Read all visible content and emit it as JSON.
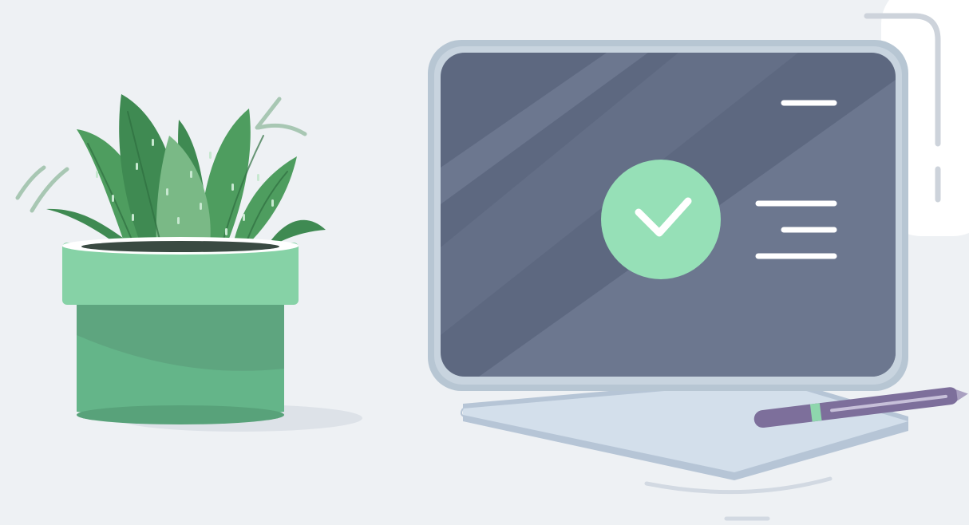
{
  "scene": {
    "subject": "",
    "colors": {
      "background": "#eef1f4",
      "card": "#ffffff",
      "card_outline": "#cdd3db",
      "pot_rim": "#86d2a6",
      "pot_body": "#64b589",
      "pot_shadow": "#58a27a",
      "leaf_dark": "#3f8a52",
      "leaf_mid": "#4e9d5f",
      "leaf_light": "#7ab986",
      "monitor_bezel": "#b7c6d3",
      "screen": "#5d6880",
      "check_circle": "#96e0b7",
      "stand": "#cfdbe8",
      "pen": "#7d6f9b"
    },
    "icons": {
      "status": "check-icon"
    }
  }
}
